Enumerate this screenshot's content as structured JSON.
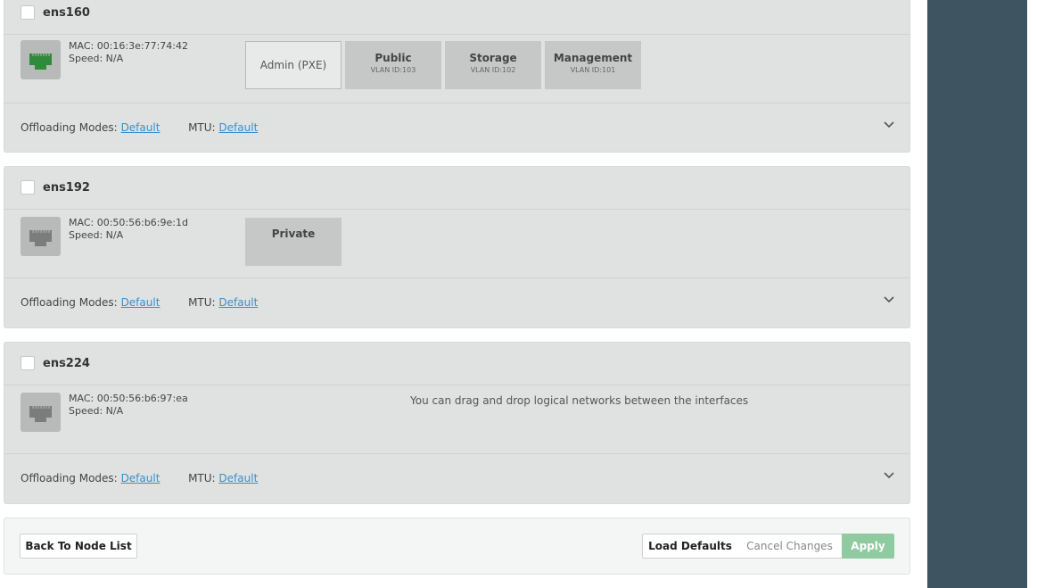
{
  "interfaces": [
    {
      "name": "ens160",
      "mac": "MAC: 00:16:3e:77:74:42",
      "speed": "Speed: N/A",
      "port_color": "#2f8a3a",
      "networks": [
        {
          "name": "Admin (PXE)",
          "vlan": ""
        },
        {
          "name": "Public",
          "vlan": "VLAN ID:103"
        },
        {
          "name": "Storage",
          "vlan": "VLAN ID:102"
        },
        {
          "name": "Management",
          "vlan": "VLAN ID:101"
        }
      ],
      "offloading_label": "Offloading Modes:",
      "offloading_value": "Default",
      "mtu_label": "MTU:",
      "mtu_value": "Default"
    },
    {
      "name": "ens192",
      "mac": "MAC: 00:50:56:b6:9e:1d",
      "speed": "Speed: N/A",
      "port_color": "#7b7d7d",
      "networks": [
        {
          "name": "Private",
          "vlan": ""
        }
      ],
      "offloading_label": "Offloading Modes:",
      "offloading_value": "Default",
      "mtu_label": "MTU:",
      "mtu_value": "Default"
    },
    {
      "name": "ens224",
      "mac": "MAC: 00:50:56:b6:97:ea",
      "speed": "Speed: N/A",
      "port_color": "#7b7d7d",
      "networks": [],
      "hint": "You can drag and drop logical networks between the interfaces",
      "offloading_label": "Offloading Modes:",
      "offloading_value": "Default",
      "mtu_label": "MTU:",
      "mtu_value": "Default"
    }
  ],
  "actions": {
    "back": "Back To Node List",
    "load_defaults": "Load Defaults",
    "cancel_changes": "Cancel Changes",
    "apply": "Apply"
  },
  "colors": {
    "apply_bg": "#8fcaa0",
    "link": "#3b8fc9",
    "sidebar_bg": "#3f5461"
  }
}
